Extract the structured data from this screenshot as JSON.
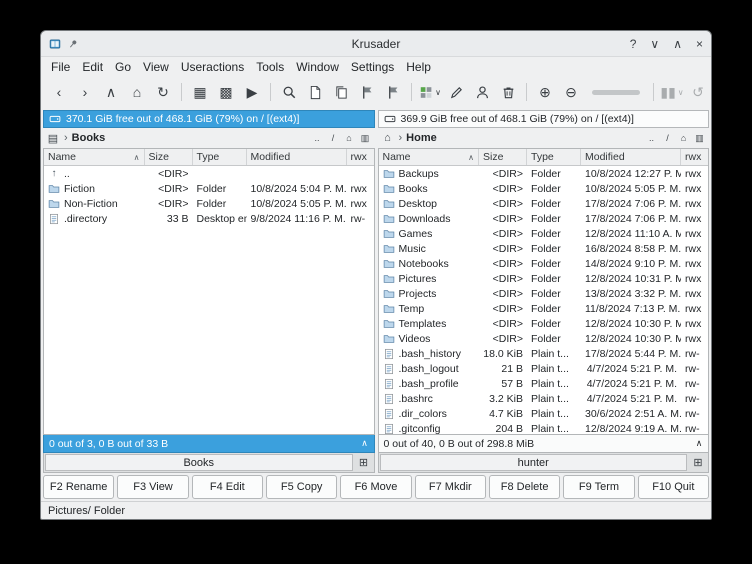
{
  "colors": {
    "accent": "#3ba0dd",
    "window_bg": "#eff0f1",
    "list_bg": "#ffffff",
    "border": "#b3b6b8",
    "text": "#232629"
  },
  "titlebar": {
    "title": "Krusader",
    "help": "?",
    "minimize": "∨",
    "maximize": "∧",
    "close": "×"
  },
  "menubar": [
    "File",
    "Edit",
    "Go",
    "View",
    "Useractions",
    "Tools",
    "Window",
    "Settings",
    "Help"
  ],
  "toolbar": [
    {
      "name": "back-button",
      "icon": "arrow-left"
    },
    {
      "name": "forward-button",
      "icon": "arrow-right"
    },
    {
      "name": "up-button",
      "icon": "arrow-up"
    },
    {
      "name": "home-button",
      "icon": "home"
    },
    {
      "name": "refresh-button",
      "icon": "refresh"
    },
    {
      "type": "sep"
    },
    {
      "name": "compare-dirs-button",
      "icon": "compare"
    },
    {
      "name": "equal-panels-button",
      "icon": "equalize"
    },
    {
      "name": "run-command-button",
      "icon": "run"
    },
    {
      "type": "sep"
    },
    {
      "name": "search-button",
      "icon": "search"
    },
    {
      "name": "new-file-button",
      "icon": "new-file"
    },
    {
      "name": "copy-button",
      "icon": "copy"
    },
    {
      "name": "bookmark-button",
      "icon": "flag"
    },
    {
      "name": "bookmark-add-button",
      "icon": "flag-add"
    },
    {
      "type": "sep"
    },
    {
      "name": "profiles-dropdown-button",
      "icon": "grid-green",
      "caret": true
    },
    {
      "name": "edit-file-button",
      "icon": "pencil"
    },
    {
      "name": "useractions-button",
      "icon": "user"
    },
    {
      "name": "trash-button",
      "icon": "trash"
    },
    {
      "type": "sep"
    },
    {
      "name": "zoom-in-button",
      "icon": "zoom-in"
    },
    {
      "name": "zoom-out-button",
      "icon": "zoom-out"
    },
    {
      "type": "slider",
      "name": "zoom-slider"
    },
    {
      "type": "sep"
    },
    {
      "name": "pause-queue-button",
      "icon": "pause",
      "caret": true,
      "disabled": true
    },
    {
      "name": "undo-button",
      "icon": "undo",
      "disabled": true
    }
  ],
  "columns": [
    "Name",
    "Size",
    "Type",
    "Modified",
    "rwx"
  ],
  "sort_indicator": "∧",
  "crumb_separator": "›",
  "status_arrow": "∧",
  "new_tab_glyph": "⊞",
  "path_buttons": [
    {
      "name": "up-dir-button",
      "glyph": ".."
    },
    {
      "name": "root-dir-button",
      "glyph": "/"
    },
    {
      "name": "home-dir-button",
      "glyph": "⌂"
    },
    {
      "name": "sync-browse-button",
      "glyph": "▥"
    }
  ],
  "panels": {
    "left": {
      "info": "370.1 GiB free out of 468.1 GiB (79%) on / [(ext4)]",
      "path_icon": "▤",
      "breadcrumb": "Books",
      "status": "0 out of 3, 0 B out of 33 B",
      "tab": "Books",
      "rows": [
        {
          "icon": "updir",
          "icon_name": "up-dir-icon",
          "name": "..",
          "size": "<DIR>",
          "type": "",
          "modified": "",
          "rwx": ""
        },
        {
          "icon": "folder",
          "icon_name": "folder-fiction-icon",
          "name": "Fiction",
          "size": "<DIR>",
          "type": "Folder",
          "modified": "10/8/2024 5:04 P. M.",
          "rwx": "rwx"
        },
        {
          "icon": "folder",
          "icon_name": "folder-non-fiction-icon",
          "name": "Non-Fiction",
          "size": "<DIR>",
          "type": "Folder",
          "modified": "10/8/2024 5:05 P. M.",
          "rwx": "rwx"
        },
        {
          "icon": "textfile",
          "icon_name": "desktop-entry-icon",
          "name": ".directory",
          "size": "33 B",
          "type": "Desktop en...",
          "modified": "9/8/2024 11:16 P. M.",
          "rwx": "rw-"
        }
      ]
    },
    "right": {
      "info": "369.9 GiB free out of 468.1 GiB (79%) on / [(ext4)]",
      "path_icon": "⌂",
      "breadcrumb": "Home",
      "status": "0 out of 40, 0 B out of 298.8 MiB",
      "tab": "hunter",
      "rows": [
        {
          "icon": "folder",
          "icon_name": "folder-backups-icon",
          "name": "Backups",
          "size": "<DIR>",
          "type": "Folder",
          "modified": "10/8/2024 12:27 P. M.",
          "rwx": "rwx"
        },
        {
          "icon": "folder",
          "icon_name": "folder-books-icon",
          "name": "Books",
          "size": "<DIR>",
          "type": "Folder",
          "modified": "10/8/2024 5:05 P. M.",
          "rwx": "rwx"
        },
        {
          "icon": "folder",
          "icon_name": "folder-desktop-icon",
          "name": "Desktop",
          "size": "<DIR>",
          "type": "Folder",
          "modified": "17/8/2024 7:06 P. M.",
          "rwx": "rwx"
        },
        {
          "icon": "folder",
          "icon_name": "folder-downloads-icon",
          "name": "Downloads",
          "size": "<DIR>",
          "type": "Folder",
          "modified": "17/8/2024 7:06 P. M.",
          "rwx": "rwx"
        },
        {
          "icon": "folder",
          "icon_name": "folder-games-icon",
          "name": "Games",
          "size": "<DIR>",
          "type": "Folder",
          "modified": "12/8/2024 11:10 A. M.",
          "rwx": "rwx"
        },
        {
          "icon": "folder",
          "icon_name": "folder-music-icon",
          "name": "Music",
          "size": "<DIR>",
          "type": "Folder",
          "modified": "16/8/2024 8:58 P. M.",
          "rwx": "rwx"
        },
        {
          "icon": "folder",
          "icon_name": "folder-notebooks-icon",
          "name": "Notebooks",
          "size": "<DIR>",
          "type": "Folder",
          "modified": "14/8/2024 9:10 P. M.",
          "rwx": "rwx"
        },
        {
          "icon": "folder",
          "icon_name": "folder-pictures-icon",
          "name": "Pictures",
          "size": "<DIR>",
          "type": "Folder",
          "modified": "12/8/2024 10:31 P. M.",
          "rwx": "rwx"
        },
        {
          "icon": "folder",
          "icon_name": "folder-projects-icon",
          "name": "Projects",
          "size": "<DIR>",
          "type": "Folder",
          "modified": "13/8/2024 3:32 P. M.",
          "rwx": "rwx"
        },
        {
          "icon": "folder",
          "icon_name": "folder-temp-icon",
          "name": "Temp",
          "size": "<DIR>",
          "type": "Folder",
          "modified": "11/8/2024 7:13 P. M.",
          "rwx": "rwx"
        },
        {
          "icon": "folder",
          "icon_name": "folder-templates-icon",
          "name": "Templates",
          "size": "<DIR>",
          "type": "Folder",
          "modified": "12/8/2024 10:30 P. M.",
          "rwx": "rwx"
        },
        {
          "icon": "folder",
          "icon_name": "folder-videos-icon",
          "name": "Videos",
          "size": "<DIR>",
          "type": "Folder",
          "modified": "12/8/2024 10:30 P. M.",
          "rwx": "rwx"
        },
        {
          "icon": "textfile",
          "icon_name": "text-file-icon",
          "name": ".bash_history",
          "size": "18.0 KiB",
          "type": "Plain t...",
          "modified": "17/8/2024 5:44 P. M.",
          "rwx": "rw-"
        },
        {
          "icon": "textfile",
          "icon_name": "text-file-icon",
          "name": ".bash_logout",
          "size": "21 B",
          "type": "Plain t...",
          "modified": "4/7/2024 5:21 P. M.",
          "rwx": "rw-"
        },
        {
          "icon": "textfile",
          "icon_name": "text-file-icon",
          "name": ".bash_profile",
          "size": "57 B",
          "type": "Plain t...",
          "modified": "4/7/2024 5:21 P. M.",
          "rwx": "rw-"
        },
        {
          "icon": "textfile",
          "icon_name": "text-file-icon",
          "name": ".bashrc",
          "size": "3.2 KiB",
          "type": "Plain t...",
          "modified": "4/7/2024 5:21 P. M.",
          "rwx": "rw-"
        },
        {
          "icon": "textfile",
          "icon_name": "text-file-icon",
          "name": ".dir_colors",
          "size": "4.7 KiB",
          "type": "Plain t...",
          "modified": "30/6/2024 2:51 A. M.",
          "rwx": "rw-"
        },
        {
          "icon": "textfile",
          "icon_name": "text-file-icon",
          "name": ".gitconfig",
          "size": "204 B",
          "type": "Plain t...",
          "modified": "12/8/2024 9:19 A. M.",
          "rwx": "rw-"
        }
      ]
    }
  },
  "fkeys": [
    "F2 Rename",
    "F3 View",
    "F4 Edit",
    "F5 Copy",
    "F6 Move",
    "F7 Mkdir",
    "F8 Delete",
    "F9 Term",
    "F10 Quit"
  ],
  "statusbar_text": "Pictures/ Folder"
}
